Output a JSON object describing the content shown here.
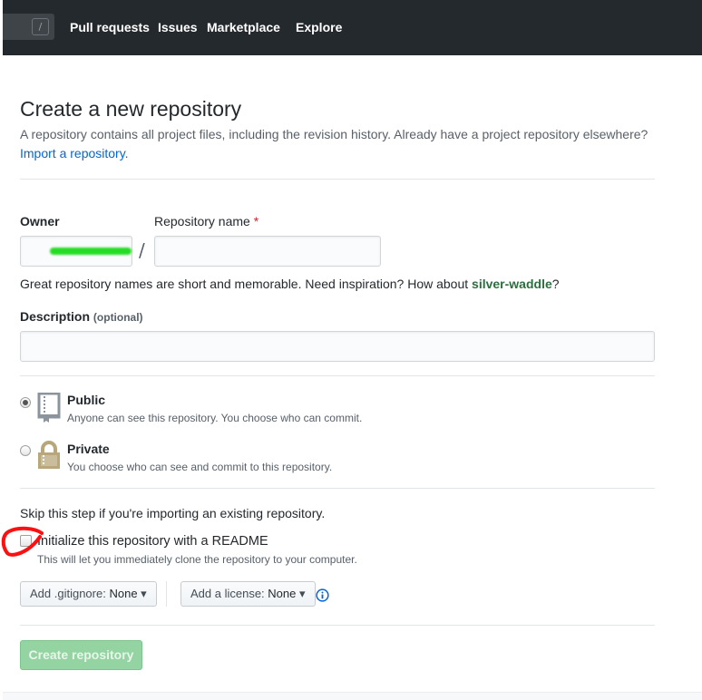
{
  "nav": {
    "search_shortcut": "/",
    "links": [
      "Pull requests",
      "Issues",
      "Marketplace",
      "Explore"
    ]
  },
  "page": {
    "title": "Create a new repository",
    "description": "A repository contains all project files, including the revision history. Already have a project repository elsewhere?",
    "import_link": "Import a repository."
  },
  "form": {
    "owner_label": "Owner",
    "repo_name_label": "Repository name",
    "required_mark": "*",
    "separator": "/",
    "repo_name_value": "",
    "hint_prefix": "Great repository names are short and memorable. Need inspiration? How about",
    "hint_suggestion": "silver-waddle",
    "hint_suffix": "?",
    "description_label": "Description",
    "description_optional": "(optional)",
    "description_value": "",
    "visibility": {
      "selected": "public",
      "public_label": "Public",
      "public_desc": "Anyone can see this repository. You choose who can commit.",
      "private_label": "Private",
      "private_desc": "You choose who can see and commit to this repository."
    },
    "skip_note": "Skip this step if you're importing an existing repository.",
    "readme_label": "Initialize this repository with a README",
    "readme_desc": "This will let you immediately clone the repository to your computer.",
    "readme_checked": false,
    "gitignore_prefix": "Add .gitignore:",
    "gitignore_value": "None",
    "license_prefix": "Add a license:",
    "license_value": "None",
    "create_button": "Create repository"
  },
  "colors": {
    "nav_bg": "#24292e",
    "link": "#0366d6",
    "create_button": "#94d3a2",
    "annotation": "#ff0000",
    "redaction": "#22dd22"
  }
}
